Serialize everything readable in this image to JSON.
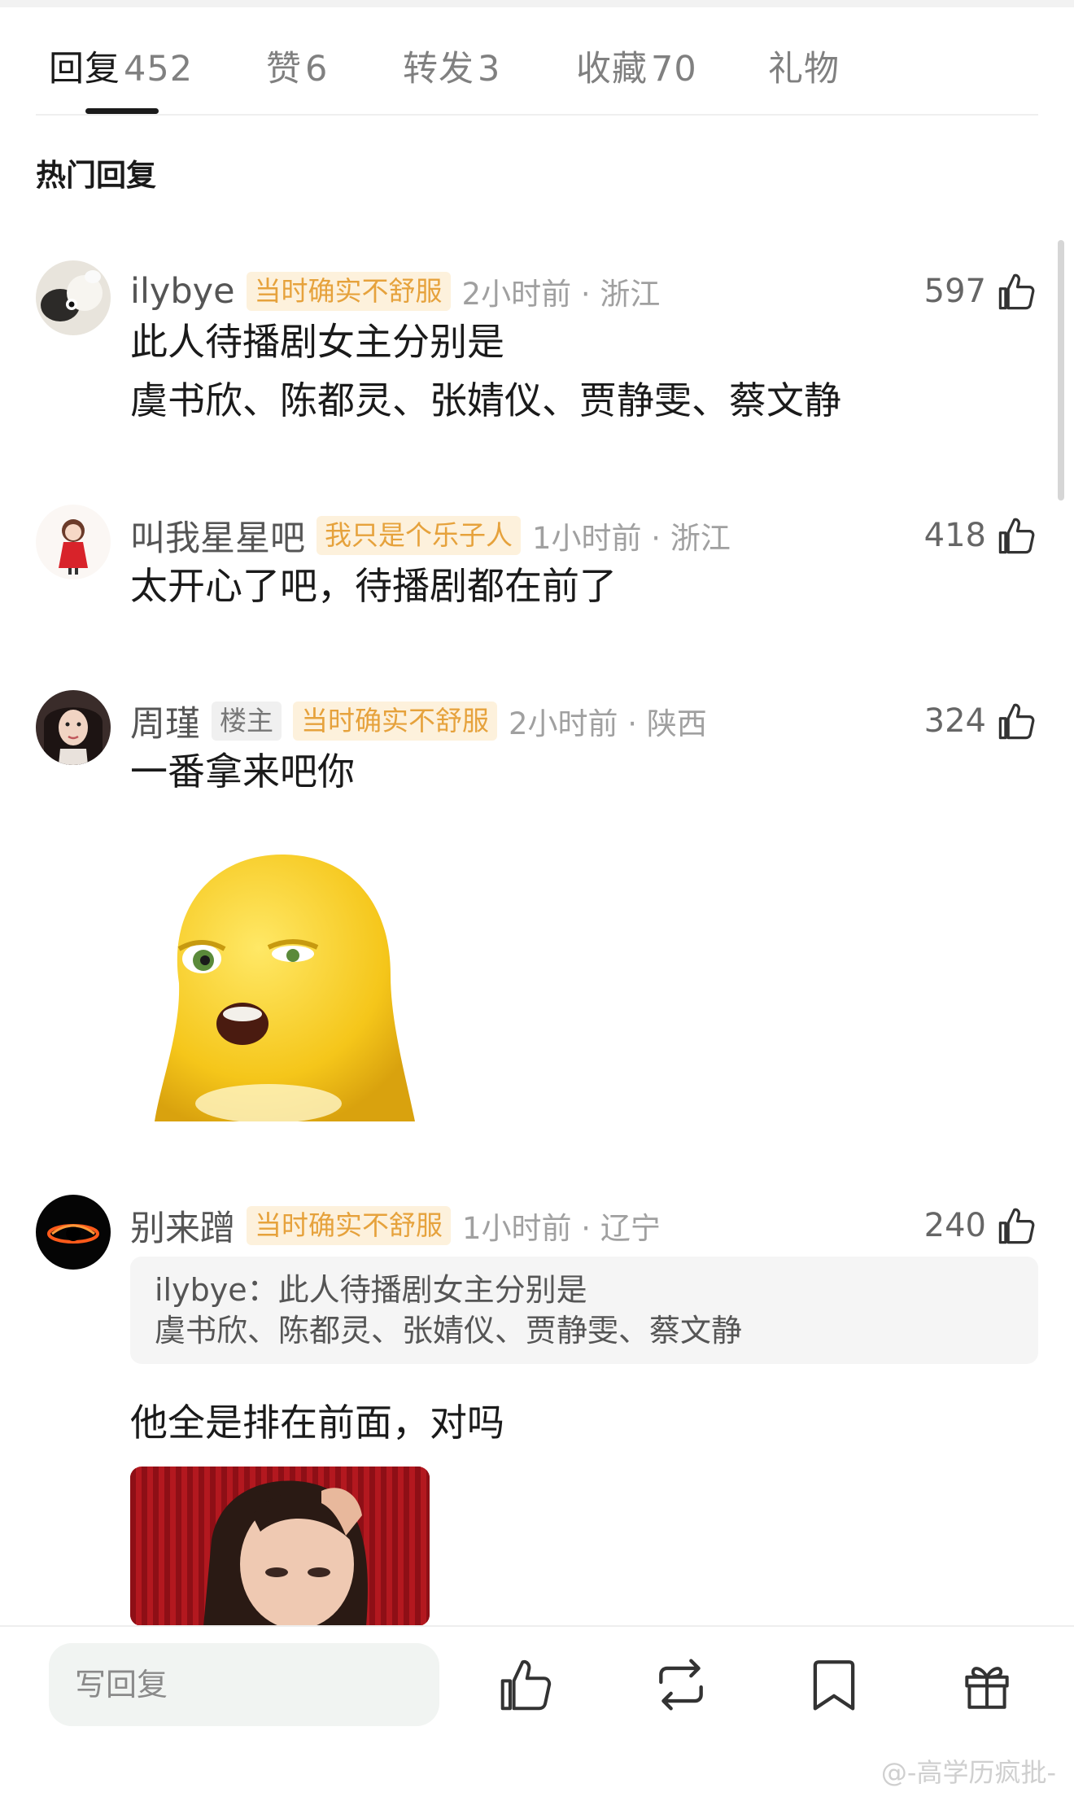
{
  "tabs": [
    {
      "name": "回复",
      "count": "452"
    },
    {
      "name": "赞",
      "count": "6"
    },
    {
      "name": "转发",
      "count": "3"
    },
    {
      "name": "收藏",
      "count": "70"
    },
    {
      "name": "礼物",
      "count": ""
    }
  ],
  "section_title": "热门回复",
  "comments": [
    {
      "username": "ilybye",
      "badge": "当时确实不舒服",
      "meta": "2小时前 · 浙江",
      "likes": "597",
      "lines": [
        "此人待播剧女主分别是",
        "虞书欣、陈都灵、张婧仪、贾静雯、蔡文静"
      ]
    },
    {
      "username": "叫我星星吧",
      "badge": "我只是个乐子人",
      "meta": "1小时前 · 浙江",
      "likes": "418",
      "lines": [
        "太开心了吧，待播剧都在前了"
      ]
    },
    {
      "username": "周瑾",
      "owner_badge": "楼主",
      "badge": "当时确实不舒服",
      "meta": "2小时前 · 陕西",
      "likes": "324",
      "lines": [
        "一番拿来吧你"
      ]
    },
    {
      "username": "别来蹭",
      "badge": "当时确实不舒服",
      "meta": "1小时前 · 辽宁",
      "likes": "240",
      "quote_author": "ilybye：",
      "quote_lines": [
        "此人待播剧女主分别是",
        "虞书欣、陈都灵、张婧仪、贾静雯、蔡文静"
      ],
      "lines": [
        "他全是排在前面，对吗"
      ]
    }
  ],
  "bottom_bar": {
    "reply_placeholder": "写回复"
  },
  "watermark": "@-高学历疯批-",
  "colors": {
    "badge_text": "#e6a23c",
    "badge_bg": "#fdf1dc",
    "meta": "#a0a0a0",
    "username": "#555555"
  }
}
